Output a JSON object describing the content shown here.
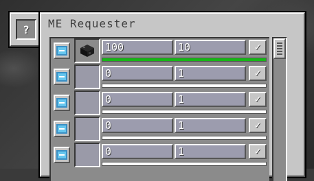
{
  "window": {
    "title": "ME Requester"
  },
  "help": {
    "label": "?"
  },
  "requests": [
    {
      "item_icon": "black-block-icon",
      "amount": "100",
      "batch": "10",
      "checked": true,
      "progress": 1.0
    },
    {
      "item_icon": "",
      "amount": "0",
      "batch": "1",
      "checked": true,
      "progress": 0
    },
    {
      "item_icon": "",
      "amount": "0",
      "batch": "1",
      "checked": true,
      "progress": 0
    },
    {
      "item_icon": "",
      "amount": "0",
      "batch": "1",
      "checked": true,
      "progress": 0
    },
    {
      "item_icon": "",
      "amount": "0",
      "batch": "1",
      "checked": true,
      "progress": 0
    }
  ],
  "check_glyph": "✓",
  "colors": {
    "progress": "#16b616",
    "button_blue": "#66c6ee"
  }
}
